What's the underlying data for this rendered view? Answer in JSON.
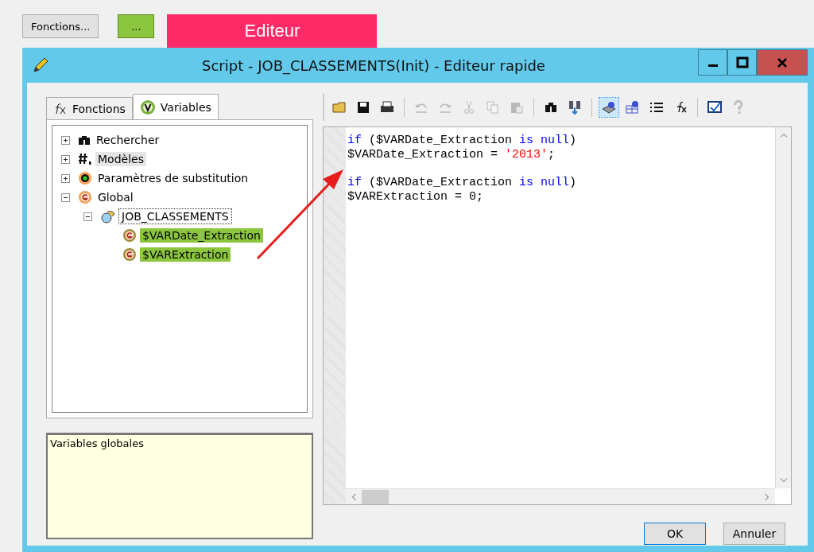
{
  "top_buttons": [
    {
      "label": "Fonctions...",
      "highlighted": false
    },
    {
      "label": "...",
      "highlighted": true
    }
  ],
  "banner": {
    "label": "Editeur"
  },
  "window": {
    "title": "Script - JOB_CLASSEMENTS(Init) - Editeur rapide"
  },
  "tabs": [
    {
      "label": "Fonctions",
      "kind": "fx",
      "selected": false
    },
    {
      "label": "Variables",
      "kind": "v",
      "selected": true
    }
  ],
  "tree": [
    {
      "label": "Rechercher",
      "kind": "binoculars",
      "expanded": false,
      "selected": false,
      "focused": false,
      "highlighted": false
    },
    {
      "label": "Modèles",
      "kind": "hash",
      "expanded": false,
      "selected": true,
      "focused": false,
      "highlighted": false
    },
    {
      "label": "Paramètres de substitution",
      "kind": "param",
      "expanded": false,
      "selected": false,
      "focused": false,
      "highlighted": false
    },
    {
      "label": "Global",
      "kind": "global",
      "expanded": true,
      "selected": false,
      "focused": false,
      "highlighted": false,
      "children": [
        {
          "label": "JOB_CLASSEMENTS",
          "kind": "job",
          "expanded": true,
          "selected": false,
          "focused": true,
          "highlighted": false,
          "children": [
            {
              "label": "$VARDate_Extraction",
              "kind": "var",
              "selected": false,
              "focused": false,
              "highlighted": true
            },
            {
              "label": "$VARExtraction",
              "kind": "var",
              "selected": false,
              "focused": false,
              "highlighted": true
            }
          ]
        }
      ]
    }
  ],
  "description": "Variables globales",
  "toolbar": [
    {
      "kind": "open",
      "disabled": false,
      "selected": false
    },
    {
      "kind": "save",
      "disabled": false,
      "selected": false
    },
    {
      "kind": "print",
      "disabled": false,
      "selected": false
    },
    {
      "kind": "sep"
    },
    {
      "kind": "undo",
      "disabled": true,
      "selected": false
    },
    {
      "kind": "redo",
      "disabled": true,
      "selected": false
    },
    {
      "kind": "cut",
      "disabled": true,
      "selected": false
    },
    {
      "kind": "copy",
      "disabled": true,
      "selected": false
    },
    {
      "kind": "paste",
      "disabled": true,
      "selected": false
    },
    {
      "kind": "sep"
    },
    {
      "kind": "find",
      "disabled": false,
      "selected": false
    },
    {
      "kind": "find-next",
      "disabled": false,
      "selected": false
    },
    {
      "kind": "sep"
    },
    {
      "kind": "view",
      "disabled": false,
      "selected": true
    },
    {
      "kind": "network",
      "disabled": false,
      "selected": false
    },
    {
      "kind": "list",
      "disabled": false,
      "selected": false
    },
    {
      "kind": "fx",
      "disabled": false,
      "selected": false
    },
    {
      "kind": "sep"
    },
    {
      "kind": "check",
      "disabled": false,
      "selected": false
    },
    {
      "kind": "help",
      "disabled": true,
      "selected": false
    }
  ],
  "code": {
    "blocks": [
      {
        "lines": [
          [
            {
              "kind": "keyword",
              "text": "if"
            },
            {
              "kind": "text",
              "text": " ($VARDate_Extraction "
            },
            {
              "kind": "keyword",
              "text": "is null"
            },
            {
              "kind": "text",
              "text": ")"
            }
          ],
          [
            {
              "kind": "text",
              "text": "$VARDate_Extraction = "
            },
            {
              "kind": "string",
              "text": "'2013'"
            },
            {
              "kind": "text",
              "text": ";"
            }
          ]
        ]
      },
      {
        "lines": [
          [
            {
              "kind": "keyword",
              "text": "if"
            },
            {
              "kind": "text",
              "text": " ($VARDate_Extraction "
            },
            {
              "kind": "keyword",
              "text": "is null"
            },
            {
              "kind": "text",
              "text": ")"
            }
          ],
          [
            {
              "kind": "text",
              "text": "$VARExtraction = 0;"
            }
          ]
        ]
      }
    ]
  },
  "buttons": [
    {
      "label": "OK",
      "default": true
    },
    {
      "label": "Annuler",
      "default": false
    }
  ]
}
